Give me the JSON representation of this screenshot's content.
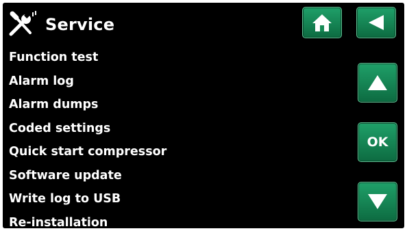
{
  "header": {
    "title": "Service",
    "icon": "service-tools-icon"
  },
  "menu": {
    "items": [
      {
        "label": "Function test"
      },
      {
        "label": "Alarm log"
      },
      {
        "label": "Alarm dumps"
      },
      {
        "label": "Coded settings"
      },
      {
        "label": "Quick start compressor"
      },
      {
        "label": "Software update"
      },
      {
        "label": "Write log to USB"
      },
      {
        "label": "Re-installation"
      }
    ]
  },
  "buttons": {
    "home_icon": "home-icon",
    "back_icon": "back-arrow-icon",
    "up_icon": "up-arrow-icon",
    "ok_label": "OK",
    "down_icon": "down-arrow-icon"
  },
  "colors": {
    "background": "#000000",
    "text": "#ffffff",
    "button_green": "#168a55"
  }
}
